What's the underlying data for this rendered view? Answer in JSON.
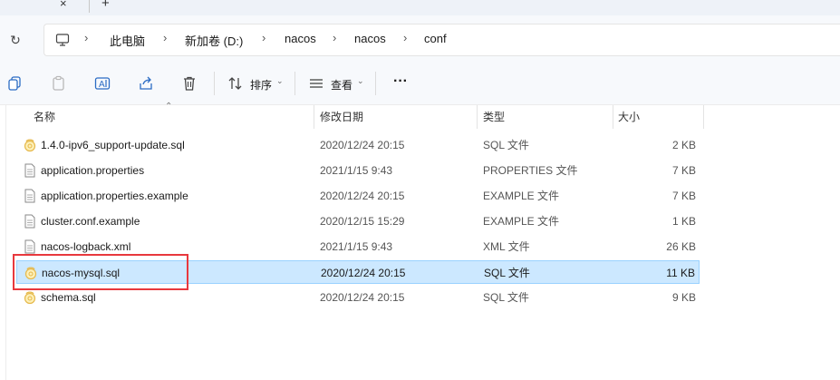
{
  "tabbar": {
    "close_glyph": "×",
    "new_tab_glyph": "+"
  },
  "breadcrumb": [
    "此电脑",
    "新加卷 (D:)",
    "nacos",
    "nacos",
    "conf"
  ],
  "toolbar": {
    "sort_label": "排序",
    "view_label": "查看",
    "more_label": "···"
  },
  "columns": {
    "name": "名称",
    "date": "修改日期",
    "type": "类型",
    "size": "大小"
  },
  "files": [
    {
      "name": "1.4.0-ipv6_support-update.sql",
      "date": "2020/12/24 20:15",
      "type": "SQL 文件",
      "size": "2 KB",
      "icon": "sql-file-icon"
    },
    {
      "name": "application.properties",
      "date": "2021/1/15 9:43",
      "type": "PROPERTIES 文件",
      "size": "7 KB",
      "icon": "document-icon"
    },
    {
      "name": "application.properties.example",
      "date": "2020/12/24 20:15",
      "type": "EXAMPLE 文件",
      "size": "7 KB",
      "icon": "document-icon"
    },
    {
      "name": "cluster.conf.example",
      "date": "2020/12/15 15:29",
      "type": "EXAMPLE 文件",
      "size": "1 KB",
      "icon": "document-icon"
    },
    {
      "name": "nacos-logback.xml",
      "date": "2021/1/15 9:43",
      "type": "XML 文件",
      "size": "26 KB",
      "icon": "document-icon"
    },
    {
      "name": "nacos-mysql.sql",
      "date": "2020/12/24 20:15",
      "type": "SQL 文件",
      "size": "11 KB",
      "icon": "sql-file-icon"
    },
    {
      "name": "schema.sql",
      "date": "2020/12/24 20:15",
      "type": "SQL 文件",
      "size": "9 KB",
      "icon": "sql-file-icon"
    }
  ],
  "selected_file": "nacos-mysql.sql",
  "colors": {
    "selection_bg": "#cce8ff",
    "selection_border": "#99d1ff",
    "annotation": "#e8383d"
  }
}
